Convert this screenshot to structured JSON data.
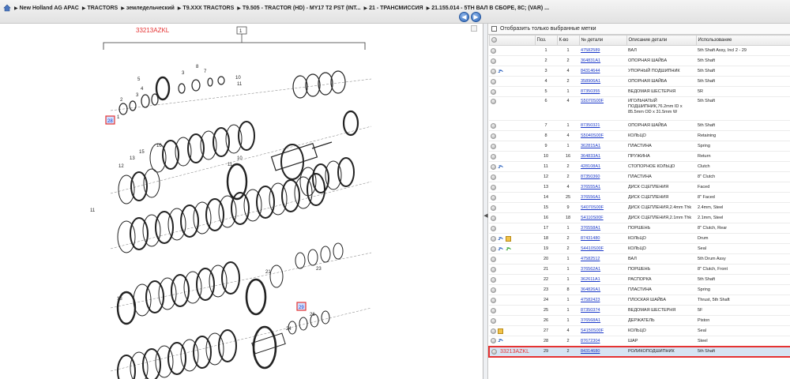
{
  "breadcrumbs": [
    "New Holland AG APAC",
    "TRACTORS",
    "земледельческий",
    "T9.XXX TRACTORS",
    "T9.505 - TRACTOR (HD) - MY17 T2 PST (INT...",
    "21 - ТРАНСМИССИЯ",
    "21.155.014 - 5TH ВАЛ В СБОРЕ, 8C; (VAR) ..."
  ],
  "diagram": {
    "code": "33213AZKL",
    "group_label": "1",
    "highlighted": [
      "28",
      "29"
    ]
  },
  "filter": {
    "label": "Отобразить только выбранные метки"
  },
  "table": {
    "headers": [
      "",
      "Поз.",
      "К-во",
      "№ детали",
      "Описание детали",
      "Использование"
    ],
    "rows": [
      {
        "icons": [],
        "pos": "1",
        "qty": "1",
        "part": "47582589",
        "desc": "ВАЛ",
        "usage": "5th Shaft Assy, Incl 2 - 29"
      },
      {
        "icons": [],
        "pos": "2",
        "qty": "2",
        "part": "364831A1",
        "desc": "ОПОРНАЯ ШАЙБА",
        "usage": "5th Shaft"
      },
      {
        "icons": [
          "arrow-blue"
        ],
        "pos": "3",
        "qty": "4",
        "part": "84314644",
        "desc": "УПОРНЫЙ ПОДШИПНИК",
        "usage": "5th Shaft"
      },
      {
        "icons": [],
        "pos": "4",
        "qty": "2",
        "part": "358906A1",
        "desc": "ОПОРНАЯ ШАЙБА",
        "usage": "5th Shaft"
      },
      {
        "icons": [],
        "pos": "5",
        "qty": "1",
        "part": "87350355",
        "desc": "ВЕДОМАЯ ШЕСТЕРНЯ",
        "usage": "5R"
      },
      {
        "icons": [],
        "pos": "6",
        "qty": "4",
        "part": "S5070S00F",
        "desc": "ИГОЛЬЧАТЫЙ ПОДШИПНИК,76.2mm ID x 85.5mm OD x 31.5mm W",
        "usage": "5th Shaft",
        "tall": true
      },
      {
        "icons": [],
        "pos": "7",
        "qty": "1",
        "part": "87350321",
        "desc": "ОПОРНАЯ ШАЙБА",
        "usage": "5th Shaft"
      },
      {
        "icons": [],
        "pos": "8",
        "qty": "4",
        "part": "S5040S00F",
        "desc": "КОЛЬЦО",
        "usage": "Retaining"
      },
      {
        "icons": [],
        "pos": "9",
        "qty": "1",
        "part": "362815A1",
        "desc": "ПЛАСТИНА",
        "usage": "Spring"
      },
      {
        "icons": [],
        "pos": "10",
        "qty": "16",
        "part": "364833A1",
        "desc": "ПРУЖИНА",
        "usage": "Return"
      },
      {
        "icons": [
          "arrow-blue"
        ],
        "pos": "11",
        "qty": "2",
        "part": "428108A1",
        "desc": "СТОПОРНОЕ КОЛЬЦО",
        "usage": "Clutch"
      },
      {
        "icons": [],
        "pos": "12",
        "qty": "2",
        "part": "87350360",
        "desc": "ПЛАСТИНА",
        "usage": "8\" Clutch"
      },
      {
        "icons": [],
        "pos": "13",
        "qty": "4",
        "part": "376555A1",
        "desc": "ДИСК СЦЕПЛЕНИЯ",
        "usage": "Faced"
      },
      {
        "icons": [],
        "pos": "14",
        "qty": "25",
        "part": "376556A1",
        "desc": "ДИСК СЦЕПЛЕНИЯ",
        "usage": "8\" Faced"
      },
      {
        "icons": [],
        "pos": "15",
        "qty": "9",
        "part": "S4070S00F",
        "desc": "ДИСК СЦЕПЛЕНИЯ,2.4mm Thk",
        "usage": "2.4mm, Steel"
      },
      {
        "icons": [],
        "pos": "16",
        "qty": "18",
        "part": "S4110S00F",
        "desc": "ДИСК СЦЕПЛЕНИЯ,2.1mm Thk",
        "usage": "2.1mm, Steel"
      },
      {
        "icons": [],
        "pos": "17",
        "qty": "1",
        "part": "376558A1",
        "desc": "ПОРШЕНЬ",
        "usage": "8\" Clutch, Rear"
      },
      {
        "icons": [
          "arrow-blue",
          "box"
        ],
        "pos": "18",
        "qty": "2",
        "part": "87431480",
        "desc": "КОЛЬЦО",
        "usage": "Drum"
      },
      {
        "icons": [
          "arrow-blue",
          "arrow-green"
        ],
        "pos": "19",
        "qty": "2",
        "part": "S4410S00F",
        "desc": "КОЛЬЦО",
        "usage": "Seal"
      },
      {
        "icons": [],
        "pos": "20",
        "qty": "1",
        "part": "47582512",
        "desc": "ВАЛ",
        "usage": "5th Drum Assy"
      },
      {
        "icons": [],
        "pos": "21",
        "qty": "1",
        "part": "376562A1",
        "desc": "ПОРШЕНЬ",
        "usage": "8\" Clutch, Front"
      },
      {
        "icons": [],
        "pos": "22",
        "qty": "1",
        "part": "362611A1",
        "desc": "РАСПОРКА",
        "usage": "5th Shaft"
      },
      {
        "icons": [],
        "pos": "23",
        "qty": "8",
        "part": "364826A1",
        "desc": "ПЛАСТИНА",
        "usage": "Spring"
      },
      {
        "icons": [],
        "pos": "24",
        "qty": "1",
        "part": "47582423",
        "desc": "ПЛОСКАЯ ШАЙБА",
        "usage": "Thrust, 5th Shaft"
      },
      {
        "icons": [],
        "pos": "25",
        "qty": "1",
        "part": "87350374",
        "desc": "ВЕДОМАЯ ШЕСТЕРНЯ",
        "usage": "5F"
      },
      {
        "icons": [],
        "pos": "26",
        "qty": "1",
        "part": "376568A1",
        "desc": "ДЕРЖАТЕЛЬ",
        "usage": "Piston"
      },
      {
        "icons": [
          "box"
        ],
        "pos": "27",
        "qty": "4",
        "part": "S4150S00F",
        "desc": "КОЛЬЦО",
        "usage": "Seal"
      },
      {
        "icons": [
          "arrow-blue"
        ],
        "pos": "28",
        "qty": "2",
        "part": "87672304",
        "desc": "ШАР",
        "usage": "Steel"
      },
      {
        "icons": [],
        "pos": "29",
        "qty": "2",
        "part": "84314680",
        "desc": "РОЛИКОПОДШИПНИК",
        "usage": "5th Shaft",
        "selected": true,
        "tag": "33213AZKL"
      }
    ]
  }
}
